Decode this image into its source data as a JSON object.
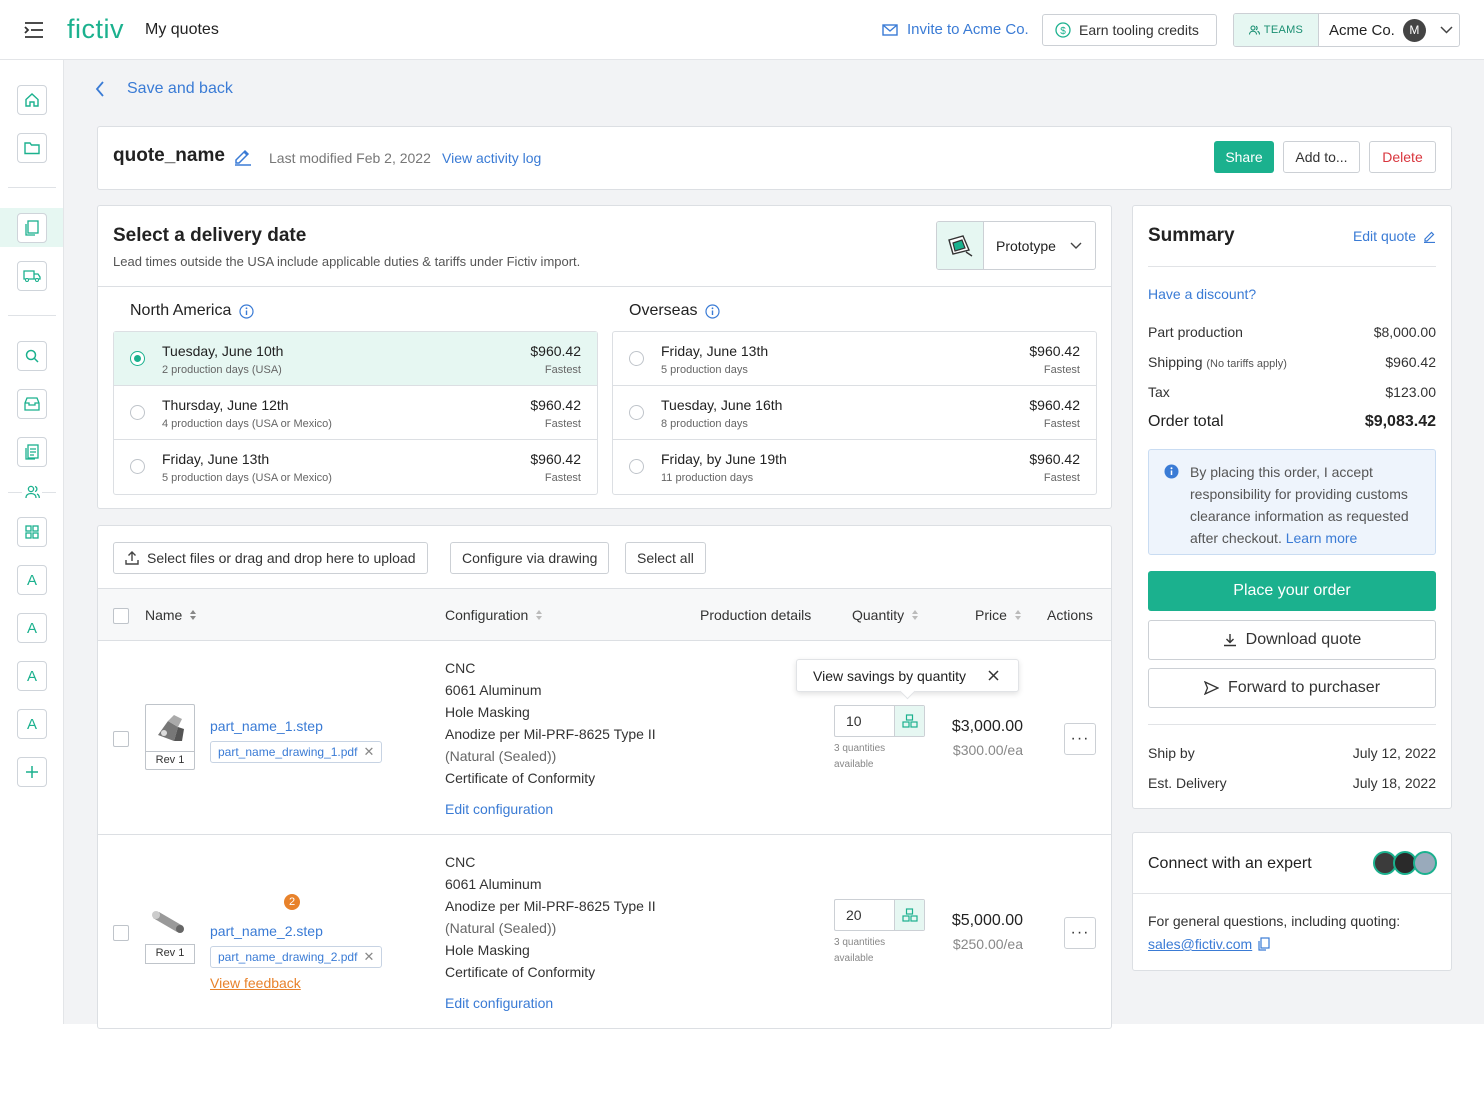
{
  "header": {
    "logo": "fictiv",
    "page_title": "My quotes",
    "invite_label": "Invite to Acme Co.",
    "earn_label": "Earn tooling credits",
    "teams_label": "TEAMS",
    "org_name": "Acme Co.",
    "avatar_initial": "M"
  },
  "sidebar": {
    "items": [
      "home-icon",
      "folder-icon",
      "quotes-icon",
      "truck-icon",
      "search-icon",
      "inbox-icon",
      "catalog-icon",
      "teams-icon",
      "grid-icon",
      "A",
      "A",
      "A",
      "A",
      "plus-icon"
    ]
  },
  "back_label": "Save and back",
  "quote": {
    "name": "quote_name",
    "last_modified": "Last modified Feb 2, 2022",
    "activity_link": "View activity log",
    "share": "Share",
    "add_to": "Add to...",
    "delete": "Delete"
  },
  "delivery": {
    "title": "Select a delivery date",
    "subtitle": "Lead times outside the USA include applicable duties & tariffs under Fictiv import.",
    "mode": "Prototype",
    "regions": [
      {
        "name": "North America",
        "options": [
          {
            "date": "Tuesday, June 10th",
            "days": "2 production days (USA)",
            "price": "$960.42",
            "tag": "Fastest",
            "selected": true
          },
          {
            "date": "Thursday, June 12th",
            "days": "4 production days (USA or Mexico)",
            "price": "$960.42",
            "tag": "Fastest",
            "selected": false
          },
          {
            "date": "Friday, June 13th",
            "days": "5 production days (USA or Mexico)",
            "price": "$960.42",
            "tag": "Fastest",
            "selected": false
          }
        ]
      },
      {
        "name": "Overseas",
        "options": [
          {
            "date": "Friday, June 13th",
            "days": "5 production days",
            "price": "$960.42",
            "tag": "Fastest",
            "selected": false
          },
          {
            "date": "Tuesday, June 16th",
            "days": "8 production days",
            "price": "$960.42",
            "tag": "Fastest",
            "selected": false
          },
          {
            "date": "Friday, by June 19th",
            "days": "11 production days",
            "price": "$960.42",
            "tag": "Fastest",
            "selected": false
          }
        ]
      }
    ]
  },
  "parts": {
    "upload_label": "Select files or drag and drop here to upload",
    "configure_label": "Configure via drawing",
    "select_all_label": "Select all",
    "columns": [
      "Name",
      "Configuration",
      "Production details",
      "Quantity",
      "Price",
      "Actions"
    ],
    "tooltip": "View savings by quantity",
    "rows": [
      {
        "rev": "Rev 1",
        "file": "part_name_1.step",
        "drawing": "part_name_drawing_1.pdf",
        "config": [
          "CNC",
          "6061 Aluminum",
          "Hole Masking",
          "Anodize per Mil-PRF-8625 Type II",
          "(Natural (Sealed))",
          "Certificate of Conformity"
        ],
        "edit": "Edit configuration",
        "qty": "10",
        "qty_note": [
          "3 quantities",
          "available"
        ],
        "price": "$3,000.00",
        "unit": "$300.00/ea"
      },
      {
        "rev": "Rev 1",
        "badge": "2",
        "file": "part_name_2.step",
        "drawing": "part_name_drawing_2.pdf",
        "feedback": "View feedback",
        "config": [
          "CNC",
          "6061 Aluminum",
          "Anodize per Mil-PRF-8625 Type II",
          "(Natural (Sealed))",
          "Hole Masking",
          "Certificate of Conformity"
        ],
        "edit": "Edit configuration",
        "qty": "20",
        "qty_note": [
          "3 quantities",
          "available"
        ],
        "price": "$5,000.00",
        "unit": "$250.00/ea"
      }
    ]
  },
  "summary": {
    "title": "Summary",
    "edit": "Edit quote",
    "discount": "Have a discount?",
    "lines": [
      {
        "label": "Part production",
        "value": "$8,000.00"
      },
      {
        "label": "Shipping",
        "note": "(No tariffs apply)",
        "value": "$960.42"
      },
      {
        "label": "Tax",
        "value": "$123.00"
      }
    ],
    "total_label": "Order total",
    "total_value": "$9,083.42",
    "notice": "By placing this order, I accept responsibility for providing customs clearance information as requested after checkout.",
    "notice_link": "Learn more",
    "place_order": "Place your order",
    "download": "Download quote",
    "forward": "Forward to purchaser",
    "ship_by_label": "Ship by",
    "ship_by": "July 12, 2022",
    "delivery_label": "Est. Delivery",
    "delivery": "July 18, 2022"
  },
  "expert": {
    "title": "Connect with an expert",
    "text": "For general questions, including quoting:",
    "email": "sales@fictiv.com"
  },
  "colors": {
    "brand": "#1bb18e",
    "link": "#3a7bd5",
    "danger": "#d9363e",
    "feedback": "#e8822b"
  }
}
